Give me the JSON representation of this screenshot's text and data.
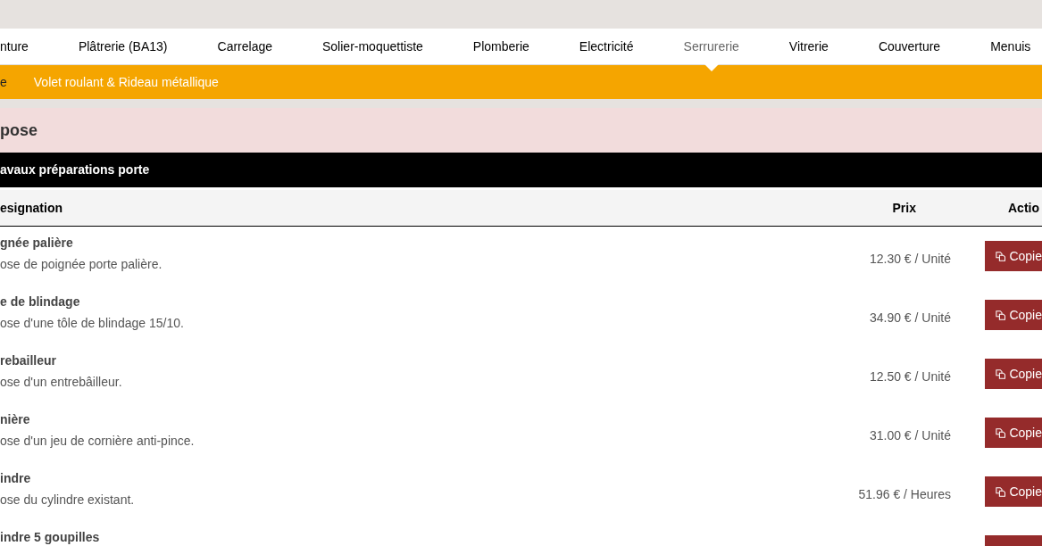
{
  "nav": [
    {
      "label": "nture",
      "selected": false
    },
    {
      "label": "Plâtrerie (BA13)",
      "selected": false
    },
    {
      "label": "Carrelage",
      "selected": false
    },
    {
      "label": "Solier-moquettiste",
      "selected": false
    },
    {
      "label": "Plomberie",
      "selected": false
    },
    {
      "label": "Electricité",
      "selected": false
    },
    {
      "label": "Serrurerie",
      "selected": true
    },
    {
      "label": "Vitrerie",
      "selected": false
    },
    {
      "label": "Couverture",
      "selected": false
    },
    {
      "label": "Menuis",
      "selected": false
    }
  ],
  "subnav": [
    {
      "label": "e",
      "selected": true
    },
    {
      "label": "Volet roulant & Rideau métallique",
      "selected": false
    }
  ],
  "section_title": "pose",
  "group_title": "avaux préparations porte",
  "table": {
    "columns": [
      "esignation",
      "Prix",
      "Actio"
    ],
    "rows": [
      {
        "title": "gnée palière",
        "description": "ose de poignée porte palière.",
        "price": "12.30 € / Unité",
        "action": "Copie"
      },
      {
        "title": "e de blindage",
        "description": "ose d'une tôle de blindage 15/10.",
        "price": "34.90 € / Unité",
        "action": "Copie"
      },
      {
        "title": "rebailleur",
        "description": "ose d'un entrebâilleur.",
        "price": "12.50 € / Unité",
        "action": "Copie"
      },
      {
        "title": "nière",
        "description": "ose d'un jeu de cornière anti-pince.",
        "price": "31.00 € / Unité",
        "action": "Copie"
      },
      {
        "title": "indre",
        "description": "ose du cylindre existant.",
        "price": "51.96 € / Heures",
        "action": "Copie"
      },
      {
        "title": "indre 5 goupilles"
      }
    ]
  }
}
